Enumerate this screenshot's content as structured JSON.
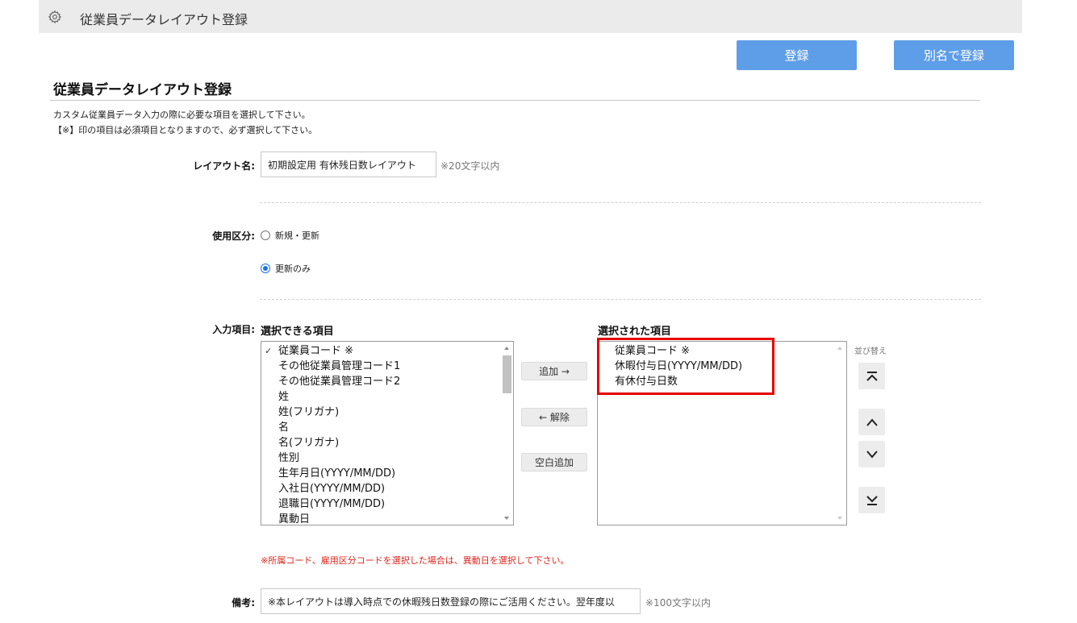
{
  "header": {
    "title": "従業員データレイアウト登録",
    "icon": "gear-icon"
  },
  "toolbar": {
    "register_label": "登録",
    "save_as_label": "別名で登録"
  },
  "page": {
    "title": "従業員データレイアウト登録",
    "description_1": "カスタム従業員データ入力の際に必要な項目を選択して下さい。",
    "description_2": "【※】印の項目は必須項目となりますので、必ず選択して下さい。"
  },
  "form": {
    "layout_name": {
      "label": "レイアウト名:",
      "value": "初期設定用 有休残日数レイアウト",
      "hint": "※20文字以内"
    },
    "usage": {
      "label": "使用区分:",
      "options": [
        {
          "label": "新規・更新",
          "checked": false
        },
        {
          "label": "更新のみ",
          "checked": true
        }
      ]
    },
    "input_items": {
      "label": "入力項目:",
      "available_title": "選択できる項目",
      "selected_title": "選択された項目",
      "available": [
        {
          "label": "従業員コード ※",
          "checked": true
        },
        {
          "label": "その他従業員管理コード1",
          "checked": false
        },
        {
          "label": "その他従業員管理コード2",
          "checked": false
        },
        {
          "label": "姓",
          "checked": false
        },
        {
          "label": "姓(フリガナ)",
          "checked": false
        },
        {
          "label": "名",
          "checked": false
        },
        {
          "label": "名(フリガナ)",
          "checked": false
        },
        {
          "label": "性別",
          "checked": false
        },
        {
          "label": "生年月日(YYYY/MM/DD)",
          "checked": false
        },
        {
          "label": "入社日(YYYY/MM/DD)",
          "checked": false
        },
        {
          "label": "退職日(YYYY/MM/DD)",
          "checked": false
        },
        {
          "label": "異動日",
          "checked": false
        }
      ],
      "selected": [
        {
          "label": "従業員コード ※"
        },
        {
          "label": "休暇付与日(YYYY/MM/DD)"
        },
        {
          "label": "有休付与日数"
        }
      ],
      "add_label": "追加 →",
      "remove_label": "← 解除",
      "blank_label": "空白追加",
      "sort_label": "並び替え"
    },
    "notice": "※所属コード、雇用区分コードを選択した場合は、異動日を選択して下さい。",
    "remarks": {
      "label": "備考:",
      "value": "※本レイアウトは導入時点での休暇残日数登録の際にご活用ください。翌年度以",
      "hint": "※100文字以内"
    }
  },
  "colors": {
    "primary_button": "#5e9ee8",
    "highlight_border": "#e60000",
    "notice_text": "#e0241b"
  }
}
